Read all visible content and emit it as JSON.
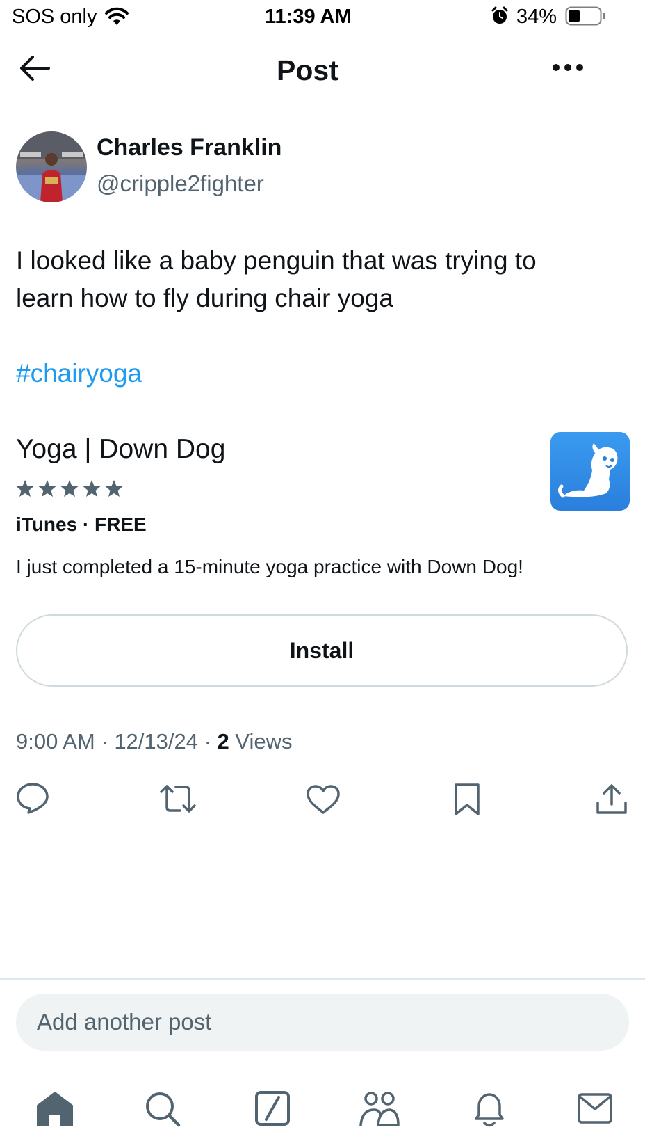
{
  "status_bar": {
    "carrier": "SOS only",
    "time": "11:39 AM",
    "battery": "34%"
  },
  "header": {
    "title": "Post"
  },
  "author": {
    "name": "Charles Franklin",
    "handle": "@cripple2fighter"
  },
  "post": {
    "text_line1": "I looked like a baby penguin that was trying to",
    "text_line2": "learn how to fly during chair yoga",
    "hashtag": "#chairyoga"
  },
  "app_card": {
    "title": "Yoga | Down Dog",
    "rating_stars": 5,
    "store": "iTunes · FREE",
    "description": "I just completed a 15-minute yoga practice with Down Dog!",
    "install_label": "Install",
    "icon": "down-dog-app-icon",
    "icon_color": "#2f8fe6"
  },
  "meta": {
    "time": "9:00 AM",
    "date": "12/13/24",
    "views_count": "2",
    "views_label": "Views"
  },
  "actions": [
    "reply-icon",
    "repost-icon",
    "like-icon",
    "bookmark-icon",
    "share-icon"
  ],
  "reply_box": {
    "placeholder": "Add another post"
  },
  "tab_bar": [
    "home-icon",
    "search-icon",
    "grok-icon",
    "communities-icon",
    "notifications-icon",
    "messages-icon"
  ],
  "colors": {
    "link": "#1d9bf0",
    "secondary_text": "#536471",
    "icon_gray": "#536471"
  }
}
